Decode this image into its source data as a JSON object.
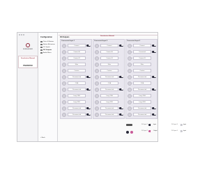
{
  "sidebar": {
    "brand": "SENNHEISER",
    "device_name": "Sennheiser Manual",
    "device_model": "PARADISO"
  },
  "config": {
    "title": "Configuration",
    "items": [
      {
        "label": "Ports & Buttons",
        "active": false
      },
      {
        "label": "Button Behaviour",
        "active": false
      },
      {
        "label": "DO Inputs",
        "active": false
      },
      {
        "label": "DO Outputs",
        "active": true
      },
      {
        "label": "Audio Mixer",
        "active": false
      }
    ],
    "back_label": "Back"
  },
  "main": {
    "title": "DO Outputs",
    "device_label": "Sennheiser Manual",
    "columns": [
      {
        "header": "Connected Input 1",
        "rows": [
          {
            "label": "Connect",
            "toggle": true
          },
          {
            "label": "Connect A",
            "toggle": false
          },
          {
            "label": "Connect B",
            "toggle": false
          },
          {
            "label": "Mute",
            "toggle": false
          },
          {
            "label": "Custom",
            "toggle": false
          },
          {
            "label": "Disconnected",
            "toggle": true
          },
          {
            "label": "Off A",
            "toggle": false
          },
          {
            "label": "Disconnected",
            "toggle": true
          },
          {
            "label": "Long Off A",
            "toggle": false
          },
          {
            "label": "Long Off B",
            "toggle": false
          },
          {
            "label": "Disconnected",
            "toggle": true
          },
          {
            "label": "Disconnected",
            "toggle": true
          }
        ]
      },
      {
        "header": "Connected Input 2",
        "rows": [
          {
            "label": "Connect",
            "toggle": true
          },
          {
            "label": "Connect A",
            "toggle": false
          },
          {
            "label": "Connect B",
            "toggle": false
          },
          {
            "label": "Mute",
            "toggle": false
          },
          {
            "label": "Custom",
            "toggle": false
          },
          {
            "label": "Disconnected",
            "toggle": true
          },
          {
            "label": "Off A",
            "toggle": false
          },
          {
            "label": "Disconnected",
            "toggle": true
          },
          {
            "label": "Long Off A",
            "toggle": false
          },
          {
            "label": "Long Off B",
            "toggle": false
          },
          {
            "label": "Disconnected",
            "toggle": true
          },
          {
            "label": "Disconnected",
            "toggle": true
          }
        ]
      },
      {
        "header": "Connected Input 3",
        "rows": [
          {
            "label": "Connect",
            "toggle": true
          },
          {
            "label": "Connected",
            "toggle": true
          },
          {
            "label": "Connect B",
            "toggle": false
          },
          {
            "label": "Mute",
            "toggle": false
          },
          {
            "label": "Custom",
            "toggle": false
          },
          {
            "label": "Disconnected",
            "toggle": true
          },
          {
            "label": "Off A",
            "toggle": false
          },
          {
            "label": "Disconnected",
            "toggle": true
          },
          {
            "label": "Long Off A",
            "toggle": false
          },
          {
            "label": "Long Off B",
            "toggle": false
          },
          {
            "label": "Disconnected",
            "toggle": true
          },
          {
            "label": "Disconnected",
            "toggle": true
          }
        ]
      }
    ]
  },
  "bottom": {
    "left_labels": [
      "DO Input 1",
      "DO Input 2"
    ],
    "left_values": [
      "Input",
      "Output"
    ],
    "right_labels": [
      "DO Input 3",
      "DO Input 4"
    ],
    "right_values": [
      "Input",
      "Input"
    ]
  },
  "colors": {
    "accent": "#9b2b3e",
    "toggle_on": "#2a2a3a",
    "toggle_pink": "#c85a98"
  }
}
